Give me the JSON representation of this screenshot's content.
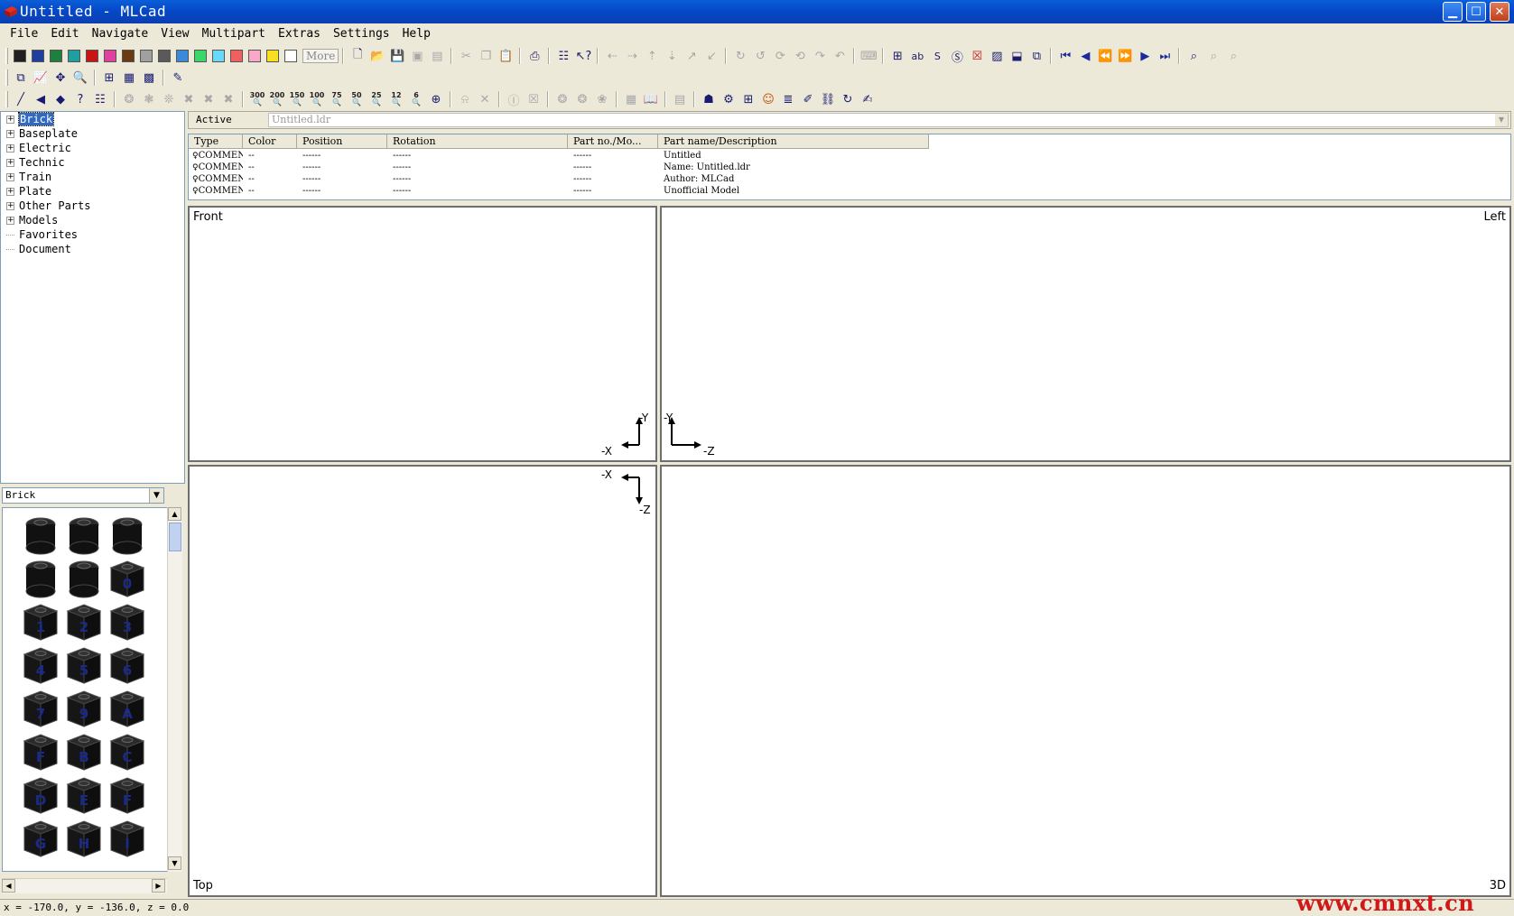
{
  "window": {
    "title": "Untitled - MLCad"
  },
  "menu": [
    "File",
    "Edit",
    "Navigate",
    "View",
    "Multipart",
    "Extras",
    "Settings",
    "Help"
  ],
  "palette": {
    "colors": [
      "#202020",
      "#1f3f9f",
      "#1f7f3f",
      "#1f9f9f",
      "#c81414",
      "#e040a0",
      "#6a3a12",
      "#a0a0a0",
      "#5a5a5a",
      "#3a8ad8",
      "#3ad86a",
      "#6ad8f8",
      "#f06060",
      "#f8a8c8",
      "#f8e020",
      "#ffffff"
    ],
    "more_label": "More"
  },
  "tree": {
    "items": [
      {
        "label": "Brick",
        "expandable": true,
        "selected": true
      },
      {
        "label": "Baseplate",
        "expandable": true
      },
      {
        "label": "Electric",
        "expandable": true
      },
      {
        "label": "Technic",
        "expandable": true
      },
      {
        "label": "Train",
        "expandable": true
      },
      {
        "label": "Plate",
        "expandable": true
      },
      {
        "label": "Other Parts",
        "expandable": true
      },
      {
        "label": "Models",
        "expandable": true
      },
      {
        "label": "Favorites",
        "expandable": false
      },
      {
        "label": "Document",
        "expandable": false
      }
    ]
  },
  "parts": {
    "category": "Brick",
    "brick_labels": [
      "",
      "",
      "",
      "",
      "",
      "0",
      "1",
      "2",
      "3",
      "4",
      "5",
      "6",
      "7",
      "9",
      "A",
      "F",
      "B",
      "C",
      "D",
      "E",
      "F",
      "G",
      "H",
      "I"
    ]
  },
  "active": {
    "label": "Active",
    "value": "Untitled.ldr"
  },
  "grid": {
    "columns": [
      "Type",
      "Color",
      "Position",
      "Rotation",
      "Part no./Mo...",
      "Part name/Description"
    ],
    "rows": [
      [
        "COMMENT",
        "--",
        "------",
        "------",
        "------",
        "Untitled"
      ],
      [
        "COMMENT",
        "--",
        "------",
        "------",
        "------",
        "Name: Untitled.ldr"
      ],
      [
        "COMMENT",
        "--",
        "------",
        "------",
        "------",
        "Author: MLCad"
      ],
      [
        "COMMENT",
        "--",
        "------",
        "------",
        "------",
        "Unofficial Model"
      ]
    ]
  },
  "viewports": {
    "front": {
      "label": "Front",
      "axis_y": "-Y",
      "axis_x": "-X"
    },
    "left": {
      "label": "Left",
      "axis_y": "-Y",
      "axis_z": "-Z"
    },
    "top": {
      "label": "Top",
      "axis_x": "-X",
      "axis_z": "-Z"
    },
    "threed": {
      "label": "3D"
    }
  },
  "status": {
    "coords": "x = -170.0, y = -136.0, z = 0.0"
  },
  "watermark": "www.cmnxt.cn"
}
